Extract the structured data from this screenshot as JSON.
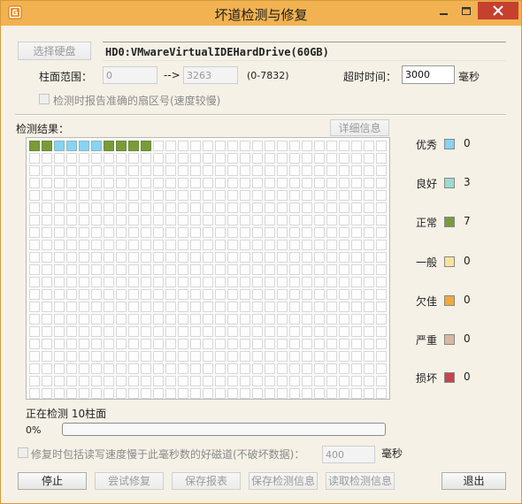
{
  "window": {
    "title": "坏道检测与修复",
    "colors": {
      "titlebar": "#f2b251",
      "close": "#c6402e",
      "background": "#f5f1e6"
    }
  },
  "drive": {
    "select_button": "选择硬盘",
    "name": "HD0:VMwareVirtualIDEHardDrive(60GB)"
  },
  "range": {
    "label": "柱面范围：",
    "from": "0",
    "arrow": "-->",
    "to": "3263",
    "hint": "(0-7832)"
  },
  "timeout": {
    "label": "超时时间：",
    "value": "3000",
    "unit": "毫秒"
  },
  "report_sector_checkbox": {
    "label": "检测时报告准确的扇区号(速度较慢)",
    "checked": false
  },
  "results": {
    "label": "检测结果：",
    "detail_button": "详细信息",
    "columns": 29,
    "rows": 21,
    "checked_blocks": [
      "good",
      "good",
      "excellent",
      "excellent",
      "excellent",
      "excellent",
      "good",
      "good",
      "good",
      "good"
    ]
  },
  "legend": [
    {
      "key": "excellent",
      "label": "优秀",
      "color": "#87d3f2",
      "count": "0"
    },
    {
      "key": "fine",
      "label": "良好",
      "color": "#9fd9cf",
      "count": "3"
    },
    {
      "key": "good",
      "label": "正常",
      "color": "#7a9b3a",
      "count": "7"
    },
    {
      "key": "normal",
      "label": "一般",
      "color": "#f7e49a",
      "count": "0"
    },
    {
      "key": "poor",
      "label": "欠佳",
      "color": "#f0a93a",
      "count": "0"
    },
    {
      "key": "serious",
      "label": "严重",
      "color": "#d7b8a2",
      "count": "0"
    },
    {
      "key": "damaged",
      "label": "损坏",
      "color": "#c8444a",
      "count": "0"
    }
  ],
  "status": {
    "text": "正在检测 10柱面",
    "percent_text": "0%",
    "progress": 0
  },
  "repair_option": {
    "label": "修复时包括读写速度慢于此毫秒数的好磁道(不破坏数据)：",
    "value": "400",
    "unit": "毫秒",
    "checked": false
  },
  "buttons": {
    "stop": "停止",
    "try_repair": "尝试修复",
    "save_report": "保存报表",
    "save_info": "保存检测信息",
    "load_info": "读取检测信息",
    "exit": "退出"
  }
}
